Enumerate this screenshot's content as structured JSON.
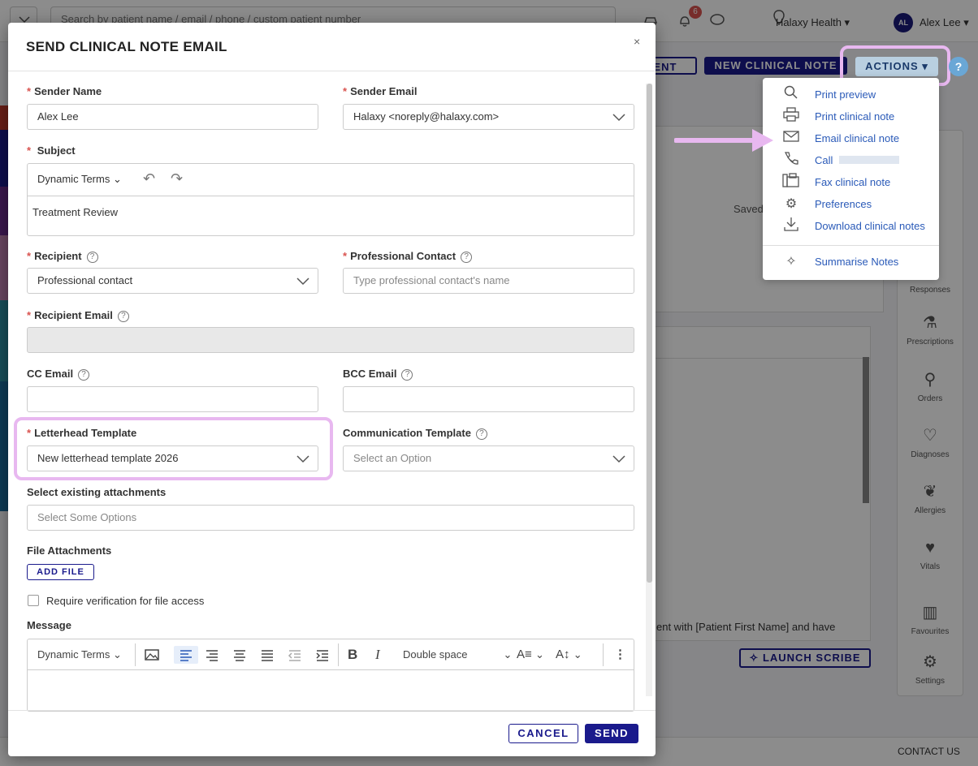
{
  "topbar": {
    "search_placeholder": "Search by patient name / email / phone / custom patient number",
    "notification_count": "6",
    "location": "Halaxy Health",
    "user_initials": "AL",
    "user_name": "Alex Lee"
  },
  "background": {
    "btn_appointment_fragment": "MENT",
    "btn_new_clinical_note": "NEW CLINICAL NOTE",
    "btn_actions": "ACTIONS",
    "saved_text": "Saved",
    "editor_text": "ent with [Patient First Name] and have",
    "launch_scribe": "LAUNCH SCRIBE",
    "contact_us": "CONTACT US",
    "rail": {
      "responses": "Responses",
      "prescriptions": "Prescriptions",
      "orders": "Orders",
      "diagnoses": "Diagnoses",
      "allergies": "Allergies",
      "vitals": "Vitals",
      "favourites": "Favourites",
      "settings": "Settings"
    }
  },
  "actions_menu": {
    "items": [
      {
        "label": "Print preview",
        "icon": "search-icon"
      },
      {
        "label": "Print clinical note",
        "icon": "printer-icon"
      },
      {
        "label": "Email clinical note",
        "icon": "envelope-icon"
      },
      {
        "label": "Call",
        "icon": "phone-icon"
      },
      {
        "label": "Fax clinical note",
        "icon": "fax-icon"
      },
      {
        "label": "Preferences",
        "icon": "gear-icon"
      },
      {
        "label": "Download clinical notes",
        "icon": "download-icon"
      },
      {
        "label": "Summarise Notes",
        "icon": "magic-wand-icon"
      }
    ]
  },
  "modal": {
    "title": "SEND CLINICAL NOTE EMAIL",
    "close": "×",
    "sender_name_label": "Sender Name",
    "sender_name_value": "Alex Lee",
    "sender_email_label": "Sender Email",
    "sender_email_value": "Halaxy <noreply@halaxy.com>",
    "subject_label": "Subject",
    "dynamic_terms": "Dynamic Terms",
    "subject_value": "Treatment Review",
    "recipient_label": "Recipient",
    "recipient_value": "Professional contact",
    "professional_contact_label": "Professional Contact",
    "professional_contact_placeholder": "Type professional contact's name",
    "recipient_email_label": "Recipient Email",
    "cc_label": "CC Email",
    "bcc_label": "BCC Email",
    "letterhead_label": "Letterhead Template",
    "letterhead_value": "New letterhead template 2026",
    "comm_template_label": "Communication Template",
    "comm_template_placeholder": "Select an Option",
    "existing_attachments_label": "Select existing attachments",
    "existing_attachments_placeholder": "Select Some Options",
    "file_attachments_label": "File Attachments",
    "add_file": "ADD FILE",
    "require_verification": "Require verification for file access",
    "message_label": "Message",
    "line_spacing": "Double space",
    "cancel": "CANCEL",
    "send": "SEND"
  },
  "colors": {
    "primary": "#1a1a8c",
    "link": "#2a5ab8",
    "required": "#d9534f",
    "highlight": "#e8b8f0"
  }
}
